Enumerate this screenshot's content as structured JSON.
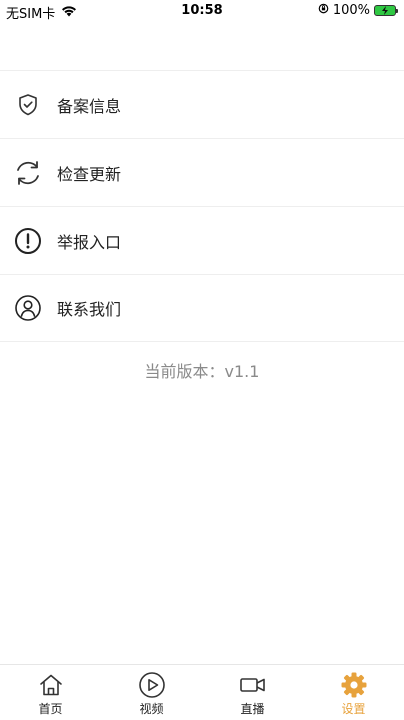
{
  "status_bar": {
    "carrier": "无SIM卡",
    "time": "10:58",
    "battery": "100%"
  },
  "menu": {
    "items": [
      {
        "label": "备案信息",
        "icon": "shield-check-icon"
      },
      {
        "label": "检查更新",
        "icon": "refresh-icon"
      },
      {
        "label": "举报入口",
        "icon": "alert-circle-icon"
      },
      {
        "label": "联系我们",
        "icon": "user-circle-icon"
      }
    ]
  },
  "version_text": "当前版本：v1.1",
  "tab_bar": {
    "tabs": [
      {
        "label": "首页",
        "icon": "home-icon",
        "active": false
      },
      {
        "label": "视频",
        "icon": "play-circle-icon",
        "active": false
      },
      {
        "label": "直播",
        "icon": "video-camera-icon",
        "active": false
      },
      {
        "label": "设置",
        "icon": "gear-icon",
        "active": true
      }
    ]
  },
  "colors": {
    "accent": "#e7a23c",
    "divider": "#eeeeee",
    "version_text": "#8a8a8a"
  }
}
